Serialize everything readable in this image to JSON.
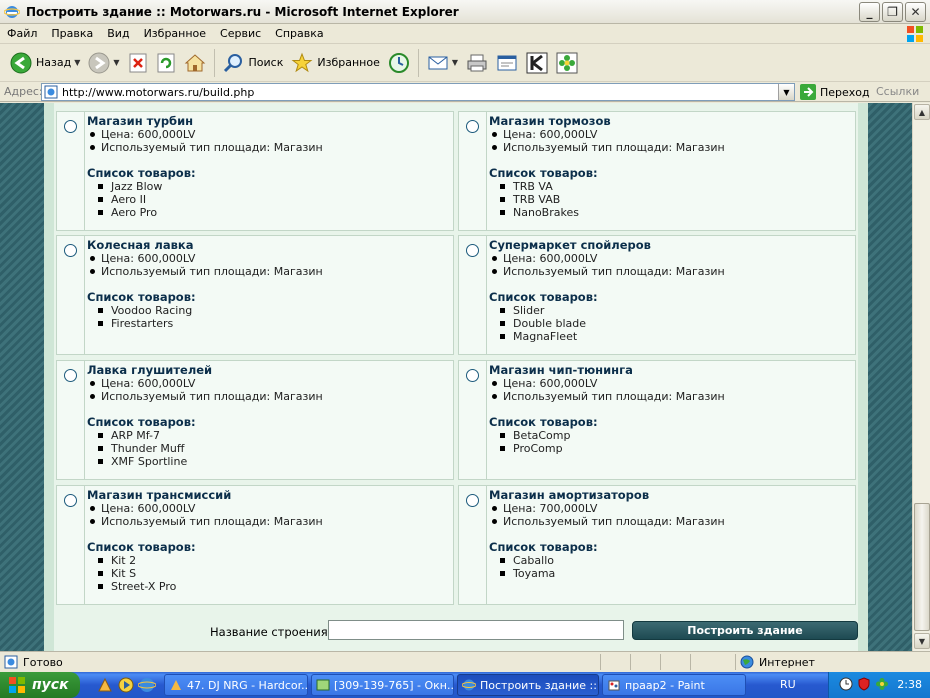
{
  "window": {
    "title": "Построить здание :: Motorwars.ru - Microsoft Internet Explorer"
  },
  "menu": [
    "Файл",
    "Правка",
    "Вид",
    "Избранное",
    "Сервис",
    "Справка"
  ],
  "toolbar": {
    "back_label": "Назад",
    "search_label": "Поиск",
    "favorites_label": "Избранное"
  },
  "address": {
    "label": "Адрес:",
    "url": "http://www.motorwars.ru/build.php",
    "go_label": "Переход",
    "links_label": "Ссылки"
  },
  "page": {
    "price_prefix": "Цена:",
    "area_prefix": "Используемый тип площади:",
    "products_title": "Список товаров:",
    "cards": [
      {
        "name": "Магазин турбин",
        "price": "Цена: 600,000LV",
        "area": "Используемый тип площади: Магазин",
        "products_title": "Список товаров:",
        "products": [
          "Jazz Blow",
          "Aero II",
          "Aero Pro"
        ]
      },
      {
        "name": "Магазин тормозов",
        "price": "Цена: 600,000LV",
        "area": "Используемый тип площади: Магазин",
        "products_title": "Список товаров:",
        "products": [
          "TRB VA",
          "TRB VAB",
          "NanoBrakes"
        ]
      },
      {
        "name": "Колесная лавка",
        "price": "Цена: 600,000LV",
        "area": "Используемый тип площади: Магазин",
        "products_title": "Список товаров:",
        "products": [
          "Voodoo Racing",
          "Firestarters"
        ]
      },
      {
        "name": "Супермаркет спойлеров",
        "price": "Цена: 600,000LV",
        "area": "Используемый тип площади: Магазин",
        "products_title": "Список товаров:",
        "products": [
          "Slider",
          "Double blade",
          "MagnaFleet"
        ]
      },
      {
        "name": "Лавка глушителей",
        "price": "Цена: 600,000LV",
        "area": "Используемый тип площади: Магазин",
        "products_title": "Список товаров:",
        "products": [
          "ARP Mf-7",
          "Thunder Muff",
          "XMF Sportline"
        ]
      },
      {
        "name": "Магазин чип-тюнинга",
        "price": "Цена: 600,000LV",
        "area": "Используемый тип площади: Магазин",
        "products_title": "Список товаров:",
        "products": [
          "BetaComp",
          "ProComp"
        ]
      },
      {
        "name": "Магазин трансмиссий",
        "price": "Цена: 600,000LV",
        "area": "Используемый тип площади: Магазин",
        "products_title": "Список товаров:",
        "products": [
          "Kit 2",
          "Kit S",
          "Street-X Pro"
        ]
      },
      {
        "name": "Магазин амортизаторов",
        "price": "Цена: 700,000LV",
        "area": "Используемый тип площади: Магазин",
        "products_title": "Список товаров:",
        "products": [
          "Caballo",
          "Toyama"
        ]
      }
    ],
    "form": {
      "name_label": "Название строения:",
      "name_value": "",
      "build_button": "Построить здание"
    }
  },
  "status": {
    "text": "Готово",
    "zone": "Интернет"
  },
  "taskbar": {
    "start_label": "пуск",
    "tasks": [
      "47. DJ NRG - Hardcor...",
      "[309-139-765] - Окн...",
      "Построить здание ::...",
      "праар2 - Paint"
    ],
    "lang": "RU",
    "clock": "2:38"
  },
  "colors": {
    "page_bg": "#3a6a72",
    "card_bg": "#f3faf5",
    "heading": "#0b2e4a",
    "button": "#2a5a62"
  }
}
